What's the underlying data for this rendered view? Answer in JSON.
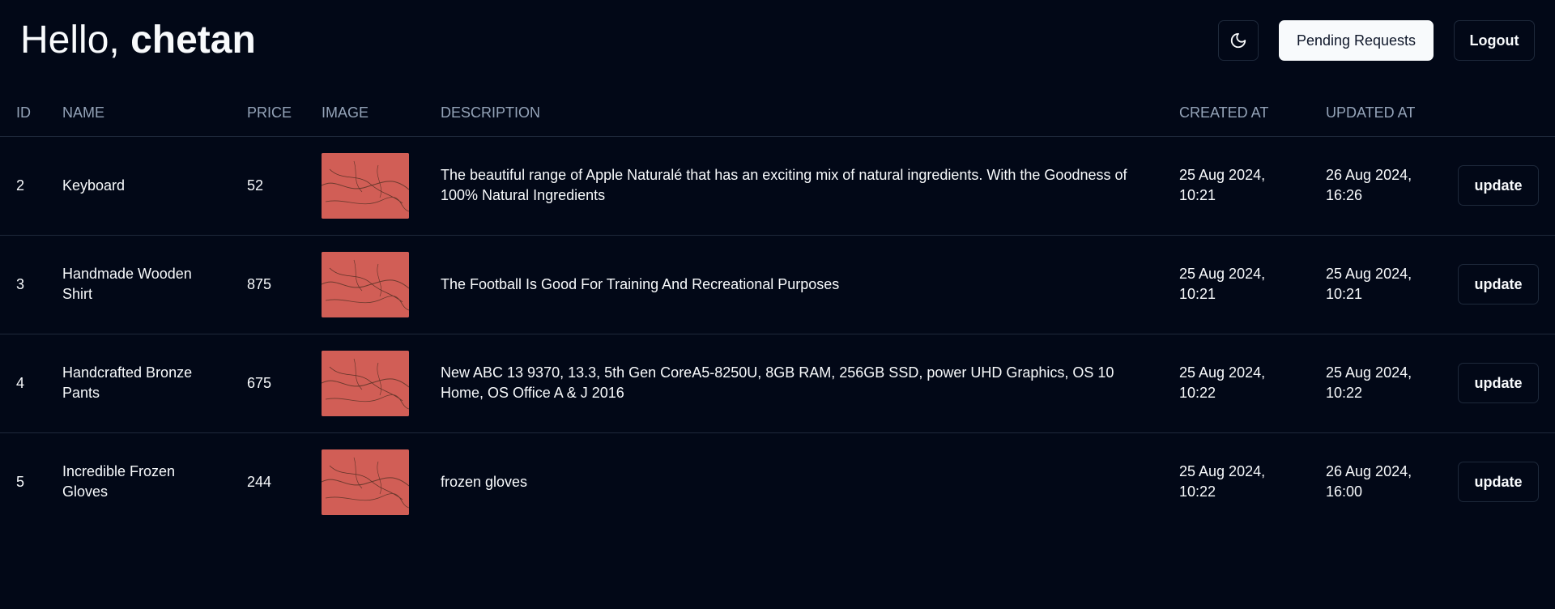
{
  "header": {
    "greeting_prefix": "Hello,",
    "username": "chetan",
    "theme_toggle_icon": "moon-icon",
    "pending_label": "Pending Requests",
    "logout_label": "Logout"
  },
  "table": {
    "columns": [
      "ID",
      "NAME",
      "PRICE",
      "IMAGE",
      "DESCRIPTION",
      "CREATED AT",
      "UPDATED AT",
      ""
    ],
    "rows": [
      {
        "id": "2",
        "name": "Keyboard",
        "price": "52",
        "description": "The beautiful range of Apple Naturalé that has an exciting mix of natural ingredients. With the Goodness of 100% Natural Ingredients",
        "created_at": "25 Aug 2024, 10:21",
        "updated_at": "26 Aug 2024, 16:26",
        "action": "update"
      },
      {
        "id": "3",
        "name": "Handmade Wooden Shirt",
        "price": "875",
        "description": "The Football Is Good For Training And Recreational Purposes",
        "created_at": "25 Aug 2024, 10:21",
        "updated_at": "25 Aug 2024, 10:21",
        "action": "update"
      },
      {
        "id": "4",
        "name": "Handcrafted Bronze Pants",
        "price": "675",
        "description": "New ABC 13 9370, 13.3, 5th Gen CoreA5-8250U, 8GB RAM, 256GB SSD, power UHD Graphics, OS 10 Home, OS Office A & J 2016",
        "created_at": "25 Aug 2024, 10:22",
        "updated_at": "25 Aug 2024, 10:22",
        "action": "update"
      },
      {
        "id": "5",
        "name": "Incredible Frozen Gloves",
        "price": "244",
        "description": "frozen gloves",
        "created_at": "25 Aug 2024, 10:22",
        "updated_at": "26 Aug 2024, 16:00",
        "action": "update"
      }
    ]
  },
  "colors": {
    "background": "#020817",
    "border": "#1e293b",
    "muted_text": "#94a3b8",
    "foreground": "#f8fafc",
    "thumbnail": "#d15e56"
  }
}
